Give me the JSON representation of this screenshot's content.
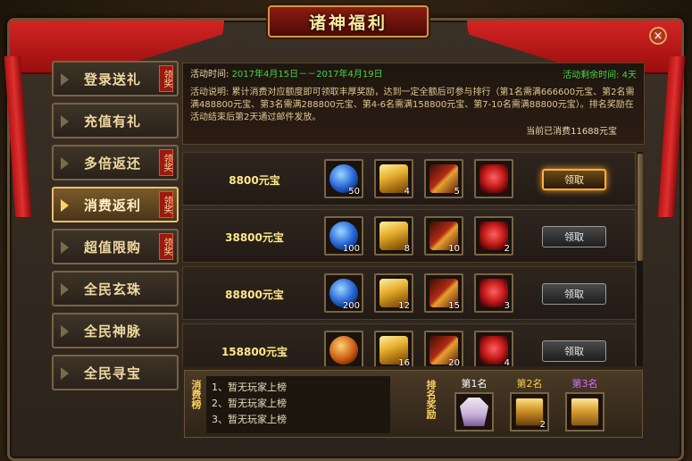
{
  "window": {
    "title": "诸神福利",
    "close_label": "×"
  },
  "sidebar": {
    "claim_tag": "领奖",
    "items": [
      {
        "label": "登录送礼",
        "claimable": true
      },
      {
        "label": "充值有礼",
        "claimable": false
      },
      {
        "label": "多倍返还",
        "claimable": true
      },
      {
        "label": "消费返利",
        "claimable": true,
        "active": true
      },
      {
        "label": "超值限购",
        "claimable": true
      },
      {
        "label": "全民玄珠",
        "claimable": false
      },
      {
        "label": "全民神脉",
        "claimable": false
      },
      {
        "label": "全民寻宝",
        "claimable": false
      }
    ]
  },
  "event": {
    "time_label": "活动时间:",
    "time_value": "2017年4月15日－－2017年4月19日",
    "remaining": "活动剩余时间: 4天",
    "description": "活动说明: 累计消费对应额度即可领取丰厚奖励，达到一定全额后可参与排行（第1名需满666600元宝、第2名需满488800元宝、第3名需满288800元宝、第4-6名需满158800元宝、第7-10名需满88800元宝）。排名奖励在活动结束后第2天通过邮件发放。",
    "spent": "当前已消费11688元宝"
  },
  "rewards": [
    {
      "amount": "8800元宝",
      "items": [
        {
          "icon": "blue-orb-icon",
          "count": "50"
        },
        {
          "icon": "gold-ingot-icon",
          "count": "4"
        },
        {
          "icon": "red-book-icon",
          "count": "5"
        },
        {
          "icon": "red-wing-icon",
          "count": ""
        }
      ],
      "button": "领取",
      "highlight": true
    },
    {
      "amount": "38800元宝",
      "items": [
        {
          "icon": "blue-orb-icon",
          "count": "100"
        },
        {
          "icon": "gold-ingot-icon",
          "count": "8"
        },
        {
          "icon": "red-book-icon",
          "count": "10"
        },
        {
          "icon": "red-wing-icon",
          "count": "2"
        }
      ],
      "button": "领取",
      "highlight": false
    },
    {
      "amount": "88800元宝",
      "items": [
        {
          "icon": "blue-orb-icon",
          "count": "200"
        },
        {
          "icon": "gold-ingot-icon",
          "count": "12"
        },
        {
          "icon": "red-book-icon",
          "count": "15"
        },
        {
          "icon": "red-wing-icon",
          "count": "3"
        }
      ],
      "button": "领取",
      "highlight": false
    },
    {
      "amount": "158800元宝",
      "items": [
        {
          "icon": "gold-orb-icon",
          "count": ""
        },
        {
          "icon": "gold-ingot-icon",
          "count": "16"
        },
        {
          "icon": "red-book-icon",
          "count": "20"
        },
        {
          "icon": "red-wing-icon",
          "count": "4"
        }
      ],
      "button": "领取",
      "highlight": false
    }
  ],
  "ranking": {
    "title": "消费榜",
    "entries": [
      "1、暂无玩家上榜",
      "2、暂无玩家上榜",
      "3、暂无玩家上榜"
    ],
    "reward_title": "排名奖励",
    "prizes": [
      {
        "label": "第1名",
        "color": "#ffffff",
        "icon": "robe-icon",
        "count": ""
      },
      {
        "label": "第2名",
        "color": "#ffd040",
        "icon": "gold-chest-icon",
        "count": "2"
      },
      {
        "label": "第3名",
        "color": "#d070ff",
        "icon": "purple-chest-icon",
        "count": ""
      }
    ]
  }
}
